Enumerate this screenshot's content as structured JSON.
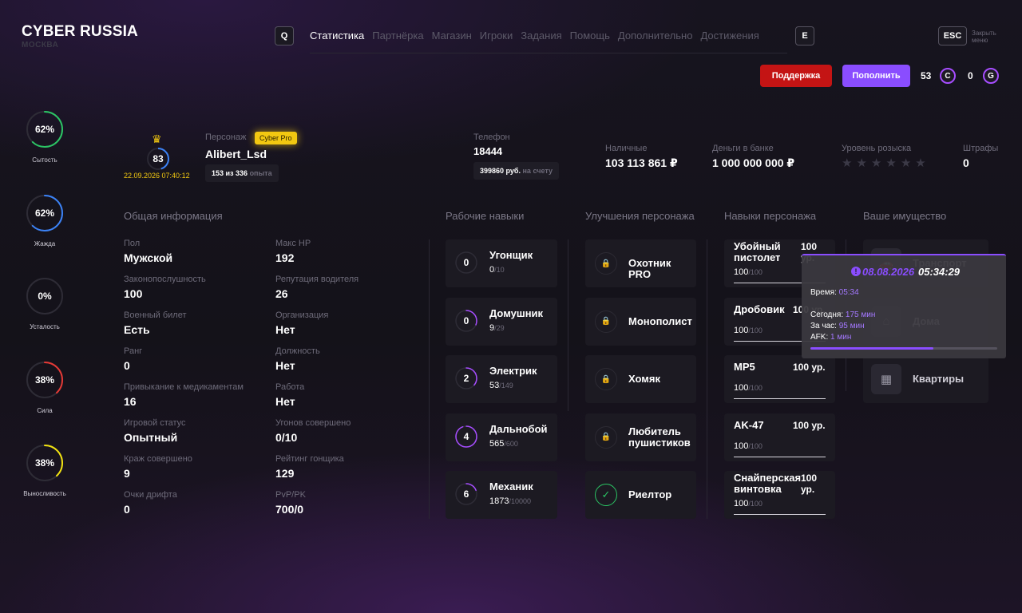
{
  "header": {
    "logo_title": "CYBER RUSSIA",
    "logo_subtitle": "МОСКВА",
    "key_prev": "Q",
    "key_next": "E",
    "key_esc": "ESC",
    "close_label": "Закрыть меню",
    "nav": [
      "Статистика",
      "Партнёрка",
      "Магазин",
      "Игроки",
      "Задания",
      "Помощь",
      "Дополнительно",
      "Достижения"
    ],
    "active_nav": "Статистика",
    "support_label": "Поддержка",
    "deposit_label": "Пополнить",
    "currency_c_amount": "53",
    "currency_c_icon": "C",
    "currency_g_amount": "0",
    "currency_g_icon": "G"
  },
  "stats": [
    {
      "percent": "62%",
      "value": 62,
      "label": "Сытость",
      "color": "#2bc464"
    },
    {
      "percent": "62%",
      "value": 62,
      "label": "Жажда",
      "color": "#3b82f6"
    },
    {
      "percent": "0%",
      "value": 0,
      "label": "Усталость",
      "color": "#9b9b9b"
    },
    {
      "percent": "38%",
      "value": 38,
      "label": "Сила",
      "color": "#e53935"
    },
    {
      "percent": "38%",
      "value": 38,
      "label": "Выносливость",
      "color": "#f2e311"
    }
  ],
  "profile": {
    "level": "83",
    "level_progress": 0.45,
    "date": "22.09.2026 07:40:12",
    "character_label": "Персонаж",
    "badge": "Cyber Pro",
    "name": "Alibert_Lsd",
    "exp_value": "153 из 336",
    "exp_suffix": "опыта",
    "phone_label": "Телефон",
    "phone": "18444",
    "phone_balance": "399860 руб.",
    "phone_balance_suffix": "на счету",
    "cash_label": "Наличные",
    "cash": "103 113 861 ₽",
    "bank_label": "Деньги в банке",
    "bank": "1 000 000 000 ₽",
    "wanted_label": "Уровень розыска",
    "wanted_stars": 0,
    "fines_label": "Штрафы",
    "fines": "0"
  },
  "general": {
    "title": "Общая информация",
    "left": [
      {
        "label": "Пол",
        "value": "Мужской"
      },
      {
        "label": "Законопослушность",
        "value": "100"
      },
      {
        "label": "Военный билет",
        "value": "Есть"
      },
      {
        "label": "Ранг",
        "value": "0"
      },
      {
        "label": "Привыкание к медикаментам",
        "value": "16"
      },
      {
        "label": "Игровой статус",
        "value": "Опытный"
      },
      {
        "label": "Краж совершено",
        "value": "9"
      },
      {
        "label": "Очки дрифта",
        "value": "0"
      }
    ],
    "right": [
      {
        "label": "Макс HP",
        "value": "192"
      },
      {
        "label": "Репутация водителя",
        "value": "26"
      },
      {
        "label": "Организация",
        "value": "Нет"
      },
      {
        "label": "Должность",
        "value": "Нет"
      },
      {
        "label": "Работа",
        "value": "Нет"
      },
      {
        "label": "Угонов совершено",
        "value": "0/10"
      },
      {
        "label": "Рейтинг гонщика",
        "value": "129"
      },
      {
        "label": "PvP/PK",
        "value": "700/0"
      }
    ]
  },
  "work_skills": {
    "title": "Рабочие навыки",
    "items": [
      {
        "level": "0",
        "name": "Угонщик",
        "current": "0",
        "max": "/10",
        "progress": 0
      },
      {
        "level": "0",
        "name": "Домушник",
        "current": "9",
        "max": "/29",
        "progress": 0.31
      },
      {
        "level": "2",
        "name": "Электрик",
        "current": "53",
        "max": "/149",
        "progress": 0.36
      },
      {
        "level": "4",
        "name": "Дальнобой",
        "current": "565",
        "max": "/600",
        "progress": 0.94
      },
      {
        "level": "6",
        "name": "Механик",
        "current": "1873",
        "max": "/10000",
        "progress": 0.19
      }
    ]
  },
  "upgrades": {
    "title": "Улучшения персонажа",
    "items": [
      {
        "name": "Охотник PRO",
        "done": false
      },
      {
        "name": "Монополист",
        "done": false
      },
      {
        "name": "Хомяк",
        "done": false
      },
      {
        "name": "Любитель пушистиков",
        "done": false
      },
      {
        "name": "Риелтор",
        "done": true
      }
    ]
  },
  "char_skills": {
    "title": "Навыки персонажа",
    "items": [
      {
        "name": "Убойный пистолет",
        "level": "100 ур.",
        "current": "100",
        "max": "/100",
        "progress": 1
      },
      {
        "name": "Дробовик",
        "level": "100 ур.",
        "current": "100",
        "max": "/100",
        "progress": 1
      },
      {
        "name": "MP5",
        "level": "100 ур.",
        "current": "100",
        "max": "/100",
        "progress": 1
      },
      {
        "name": "AK-47",
        "level": "100 ур.",
        "current": "100",
        "max": "/100",
        "progress": 1
      },
      {
        "name": "Снайперская винтовка",
        "level": "100 ур.",
        "current": "100",
        "max": "/100",
        "progress": 1
      }
    ]
  },
  "property": {
    "title": "Ваше имущество",
    "items": [
      {
        "name": "Транспорт",
        "icon": "car-icon"
      },
      {
        "name": "Дома",
        "icon": "house-icon"
      },
      {
        "name": "Квартиры",
        "icon": "building-icon"
      }
    ]
  },
  "tooltip": {
    "date": "08.08.2026",
    "time_clock": "05:34:29",
    "time_label": "Время:",
    "time_value": "05:34",
    "today_label": "Сегодня:",
    "today_value": "175 мин",
    "hour_label": "За час:",
    "hour_value": "95 мин",
    "afk_label": "AFK:",
    "afk_value": "1 мин",
    "progress": 0.66
  },
  "colors": {
    "accent": "#8a4dff",
    "support": "#c41414",
    "gold": "#f2c811"
  }
}
